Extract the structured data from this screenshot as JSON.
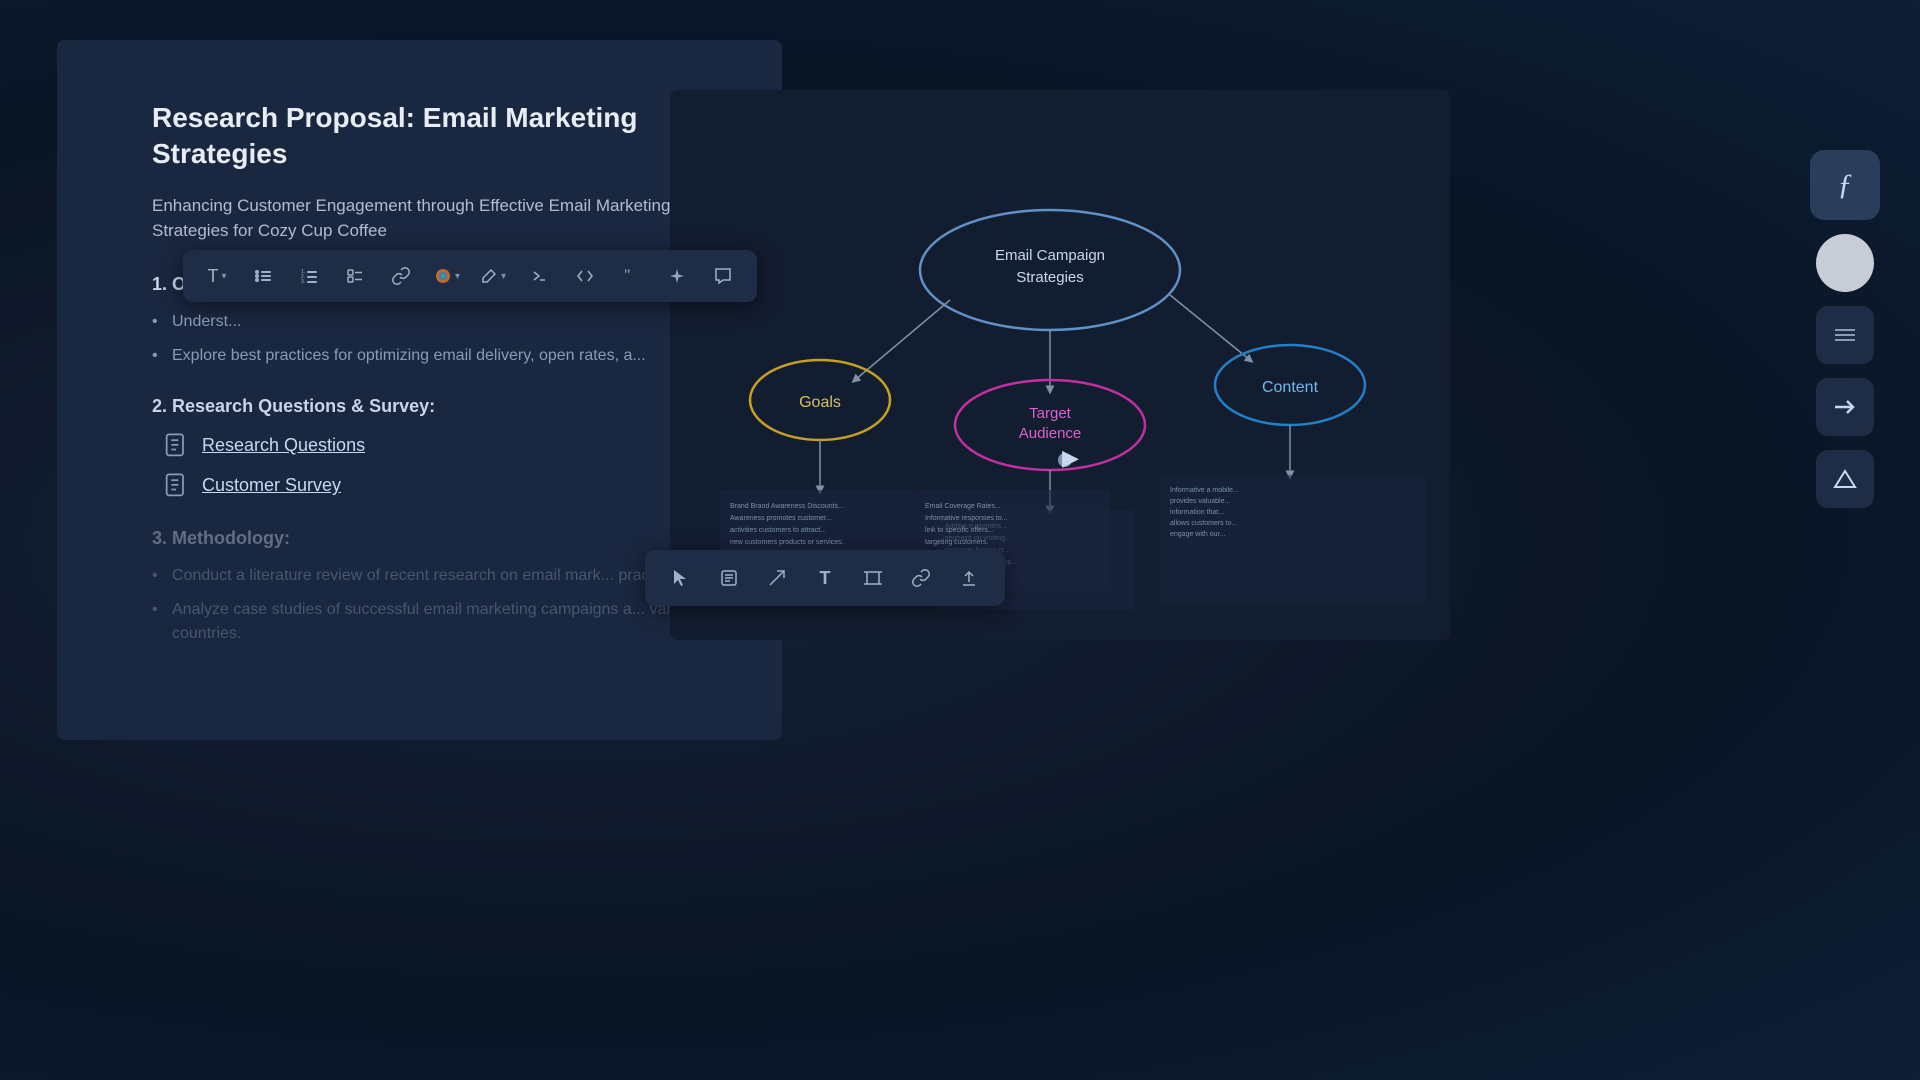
{
  "document": {
    "title": "Research Proposal: Email Marketing Strategies",
    "subtitle_line1": "Enhancing Customer Engagement through Effective Email Marketing",
    "subtitle_line2": "Strategies for Cozy Cup Coffee",
    "sections": [
      {
        "number": "1.",
        "title": "Objective",
        "bullets": [
          "Underst...",
          "Explore best practices for optimizing email delivery, open rates, a..."
        ]
      },
      {
        "number": "2.",
        "title": "Research Questions & Survey:",
        "links": [
          {
            "label": "Research Questions"
          },
          {
            "label": "Customer Survey"
          }
        ]
      },
      {
        "number": "3.",
        "title": "Methodology:",
        "bullets": [
          "Conduct a literature review of recent research on email mark... practices.",
          "Analyze case studies of successful email marketing campaigns a... various countries."
        ]
      }
    ]
  },
  "toolbar_top": {
    "buttons": [
      "T",
      "≡",
      "≡",
      "≡",
      "⌁",
      "◉",
      "✏",
      "≻",
      "<>",
      "❝",
      "✦",
      "◯"
    ]
  },
  "toolbar_bottom": {
    "buttons": [
      "cursor",
      "note",
      "arrow",
      "T",
      "select",
      "link",
      "upload"
    ]
  },
  "mindmap": {
    "center_label": "Email Campaign Strategies",
    "nodes": [
      {
        "label": "Goals",
        "color": "#c8a020"
      },
      {
        "label": "Target Audience",
        "color": "#c030a0"
      },
      {
        "label": "Content",
        "color": "#2080c8"
      }
    ]
  },
  "right_tools": {
    "buttons": [
      "script",
      "circle",
      "lines",
      "arrow"
    ]
  }
}
